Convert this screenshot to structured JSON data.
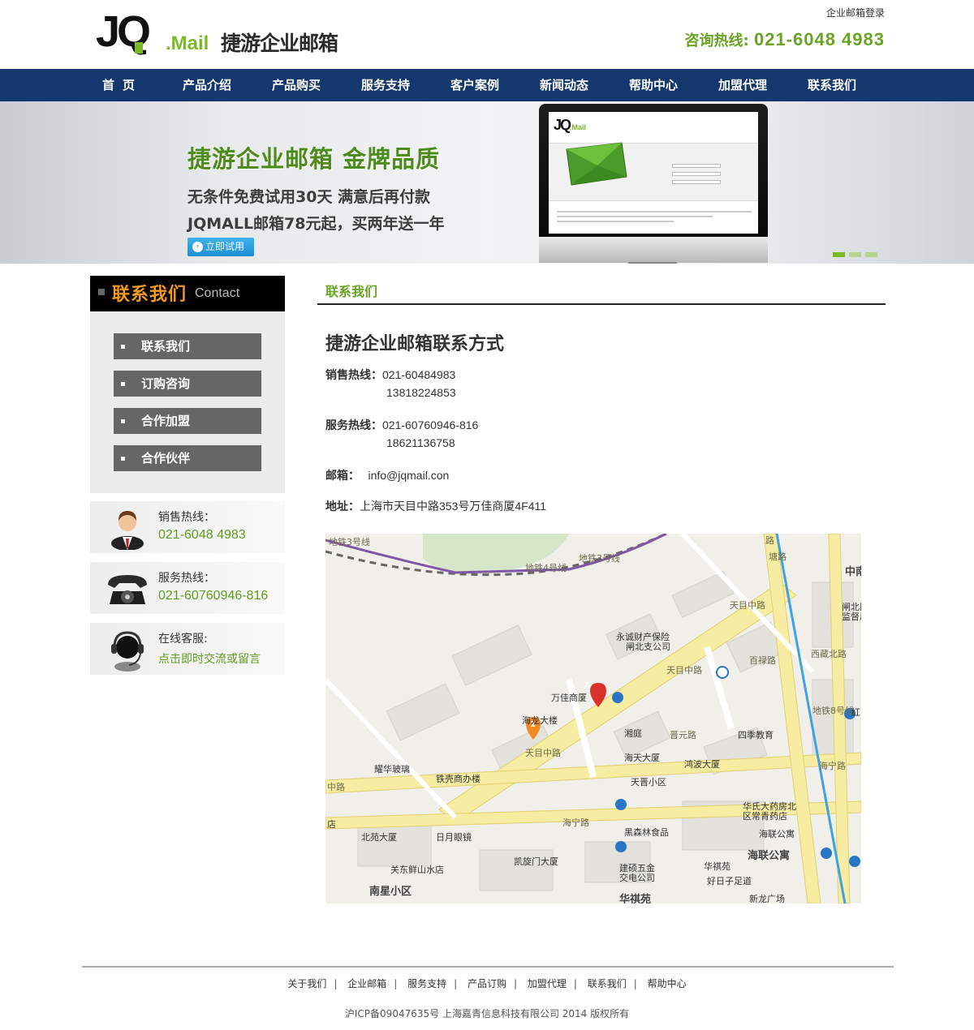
{
  "header": {
    "brand_mark": "JQ",
    "brand_suffix": ".Mail",
    "brand_name": "捷游企业邮箱",
    "login_link": "企业邮箱登录",
    "hotline_label": "咨询热线:",
    "hotline_number": "021-6048 4983"
  },
  "nav": {
    "items": [
      "首页",
      "产品介绍",
      "产品购买",
      "服务支持",
      "客户案例",
      "新闻动态",
      "帮助中心",
      "加盟代理",
      "联系我们"
    ]
  },
  "banner": {
    "title": "捷游企业邮箱  金牌品质",
    "line1": "无条件免费试用30天 满意后再付款",
    "line2": "JQMALL邮箱78元起，买两年送一年",
    "button": "立即试用",
    "slide_count": 3,
    "active_slide": 1
  },
  "sidebar": {
    "title_cn": "联系我们",
    "title_en": "Contact",
    "menu": [
      "联系我们",
      "订购咨询",
      "合作加盟",
      "合作伙伴"
    ],
    "sales": {
      "label": "销售热线：",
      "value": "021-6048 4983"
    },
    "service": {
      "label": "服务热线：",
      "value": "021-60760946-816"
    },
    "online": {
      "label": "在线客服:",
      "value": "点击即时交流或留言"
    }
  },
  "main": {
    "section_title": "联系我们",
    "article_title": "捷游企业邮箱联系方式",
    "sales_label": "销售热线：",
    "sales_phone1": "021-60484983",
    "sales_phone2": "13818224853",
    "service_label": "服务热线：",
    "service_phone1": "021-60760946-816",
    "service_phone2": "18621136758",
    "email_label": "邮箱：",
    "email": "info@jqmail.con",
    "address_label": "地址：",
    "address": "上海市天目中路353号万佳商厦4F411"
  },
  "map": {
    "labels": {
      "metro3": "地铁3号线",
      "metro4": "地铁4号线",
      "metro3b": "地铁3号线",
      "metro8": "地铁8号线",
      "yongcheng": "永诚财产保险",
      "yongcheng2": "闸北支公司",
      "wanjia": "万佳商厦",
      "tianmu1": "天目中路",
      "tianmu2": "天目中路",
      "tianmu3": "天目中路",
      "baijilu": "百禄路",
      "xizang": "西藏北路",
      "hailong": "海龙大楼",
      "xiangting": "湘庭",
      "jinyuan": "晋元路",
      "sijijiaoyu": "四季教育",
      "haitian": "海天大厦",
      "hongbo": "鸿波大厦",
      "yaohua": "耀华玻璃",
      "tieke": "铁壳商办楼",
      "tianjin": "天晋小区",
      "hainingroad": "海宁路",
      "hainingroad2": "海宁路",
      "hua": "华氏大药房北",
      "hua2": "区常青药店",
      "haiguan": "海联公寓",
      "haiguan2": "海联公寓",
      "heisenlin": "黑森林食品",
      "beiyuan": "北苑大厦",
      "riyue": "日月眼镜",
      "kaixuanmen": "凯旋门大厦",
      "guandong": "关东鲜山水店",
      "jianyin": "建硕五金",
      "jianyin2": "交电公司",
      "huaqiyuan": "华祺苑",
      "haozi": "好日子足道",
      "nanxing": "南星小区",
      "huaqiyuan2": "华祺苑",
      "xinlong": "新龙广场",
      "zhong": "中南",
      "zhabei": "闸北区",
      "zhabei2": "监督局",
      "hong": "红",
      "hu": "路",
      "shangdu": "路",
      "zhonglu": "中路",
      "dian": "店",
      "tiantong": "塘路"
    },
    "marker_a": "A",
    "marker_1": "1"
  },
  "footer": {
    "links": [
      "关于我们",
      "企业邮箱",
      "服务支持",
      "产品订购",
      "加盟代理",
      "联系我们",
      "帮助中心"
    ],
    "copyright": "沪ICP备09047635号 上海嘉青信息科技有限公司 2014 版权所有"
  },
  "colors": {
    "nav_bg": "#14386e",
    "brand_green": "#7cb928",
    "hotline_green": "#6aa324",
    "sidebar_title_orange": "#f39a1c"
  }
}
